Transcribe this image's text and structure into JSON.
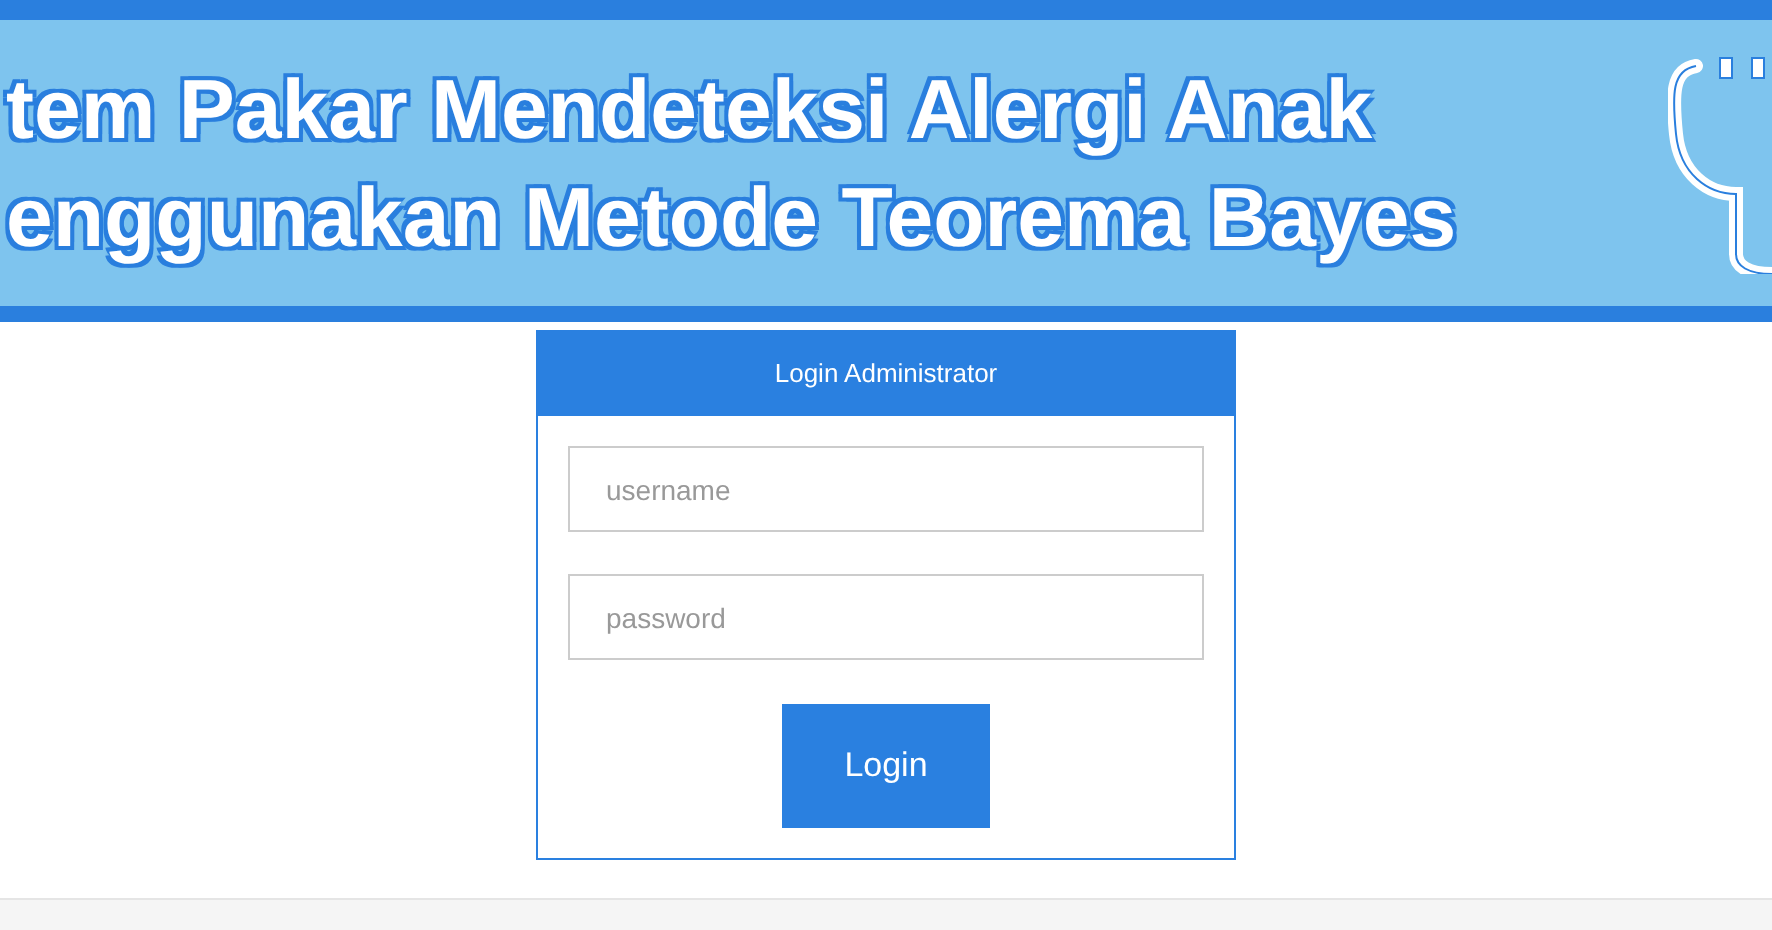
{
  "banner": {
    "lines": [
      "tem Pakar Mendeteksi Alergi Anak",
      "enggunakan Metode Teorema Bayes"
    ]
  },
  "login": {
    "title": "Login Administrator",
    "fields": [
      {
        "placeholder": "username"
      },
      {
        "placeholder": "password"
      }
    ],
    "button": "Login"
  }
}
